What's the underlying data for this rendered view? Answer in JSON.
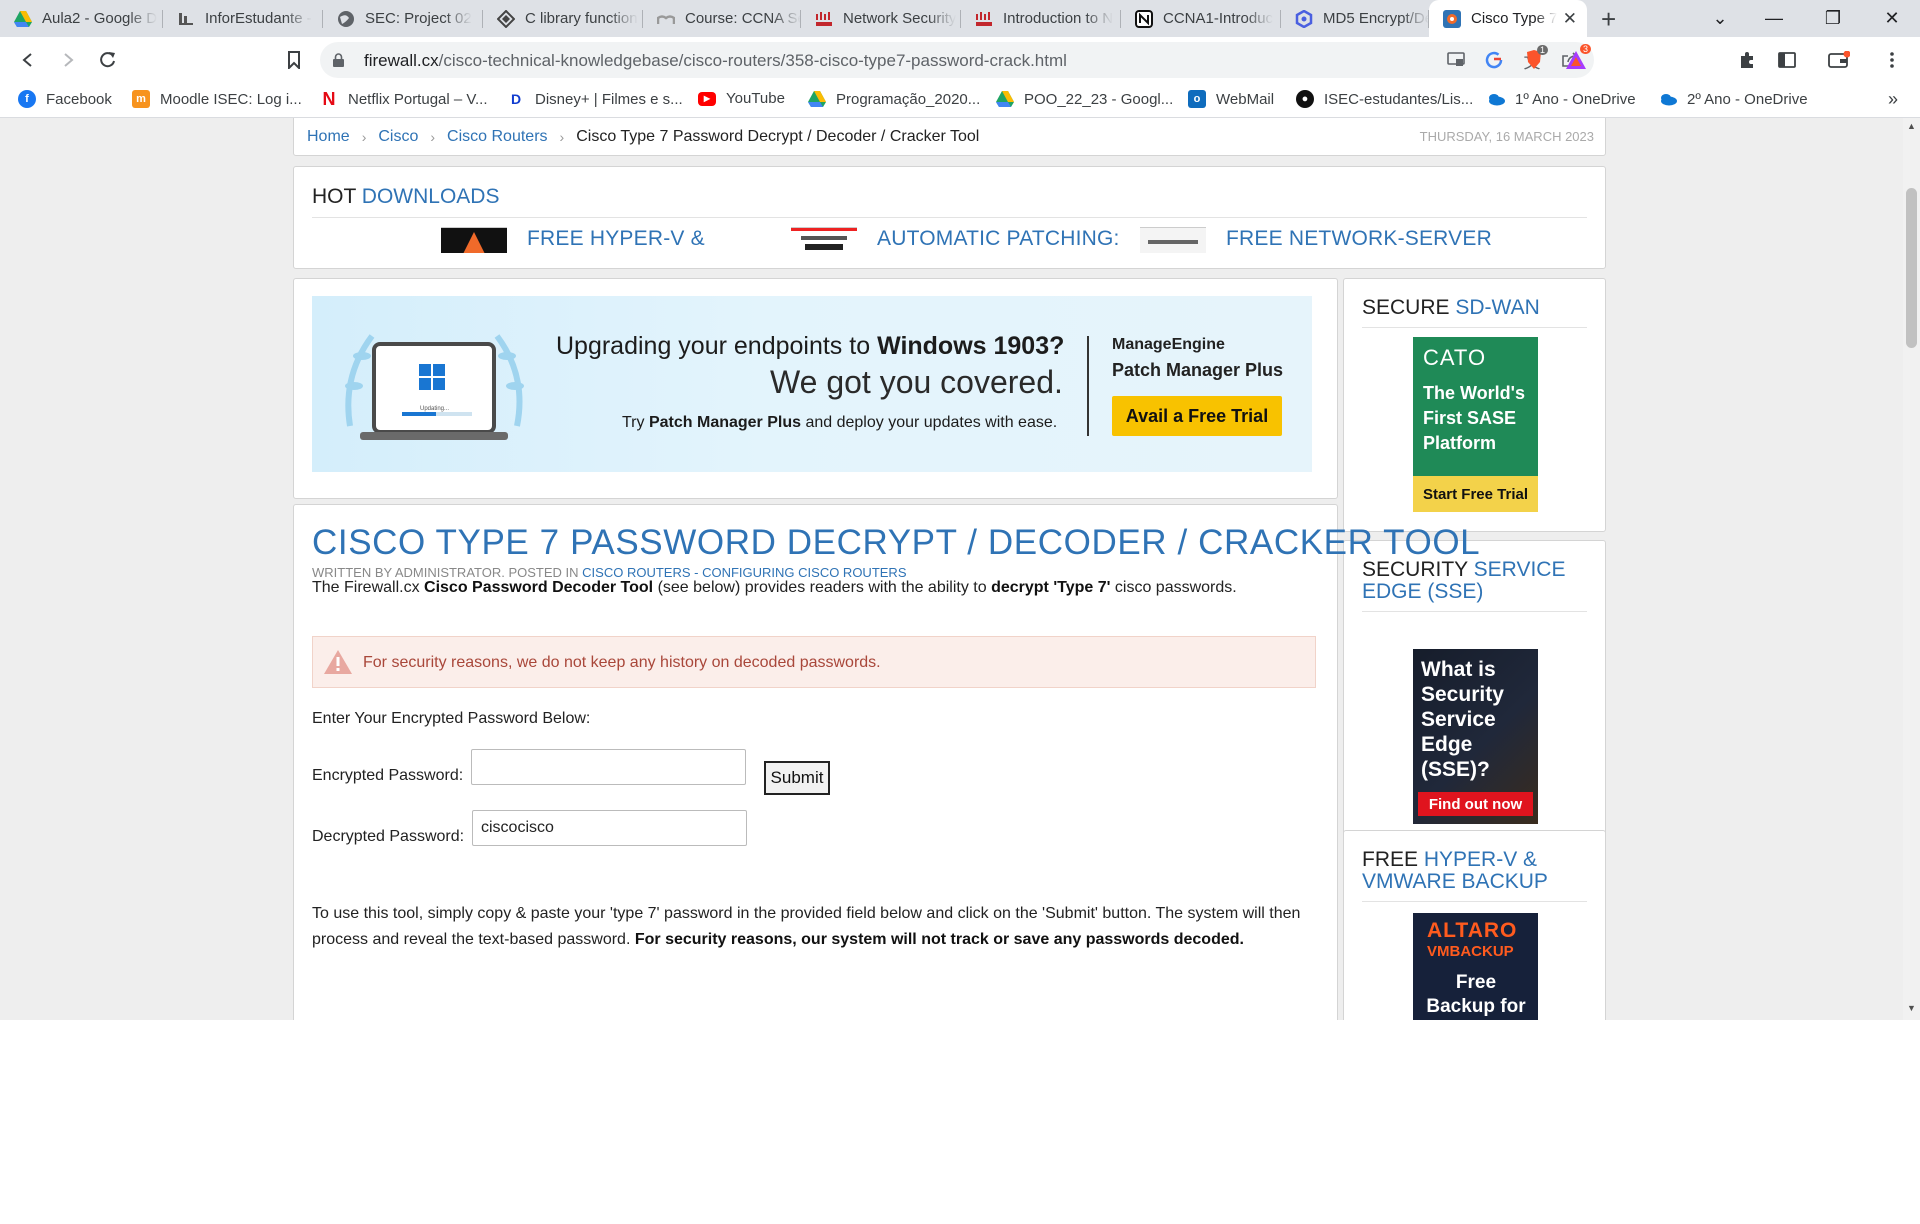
{
  "tabs": [
    {
      "label": "Aula2 - Google D",
      "icon": "google-drive-icon",
      "color": "#1fa463"
    },
    {
      "label": "InforEstudante - ",
      "icon": "inforestudante-icon",
      "color": "#555555"
    },
    {
      "label": "SEC: Project 02",
      "icon": "globe-icon",
      "color": "#5f6368"
    },
    {
      "label": "C library function",
      "icon": "tutorialspoint-icon",
      "color": "#444444"
    },
    {
      "label": "Course: CCNA Se",
      "icon": "moodle-icon",
      "color": "#999999"
    },
    {
      "label": "Network Security",
      "icon": "cisco-icon",
      "color": "#c2272d"
    },
    {
      "label": "Introduction to N",
      "icon": "cisco-icon",
      "color": "#c2272d"
    },
    {
      "label": "CCNA1-Introduc",
      "icon": "notion-icon",
      "color": "#111111"
    },
    {
      "label": "MD5 Encrypt/De",
      "icon": "md5-icon",
      "color": "#4a5fe0"
    },
    {
      "label": "Cisco Type 7",
      "icon": "firewall-cx-icon",
      "color": "#2f73b5",
      "active": true
    }
  ],
  "toolbar": {
    "url_host": "firewall.cx",
    "url_path": "/cisco-technical-knowledgebase/cisco-routers/358-cisco-type7-password-crack.html",
    "brave_badge": "1",
    "rewards_badge": "3"
  },
  "bookmarks": [
    {
      "label": "Facebook",
      "icon": "facebook-icon",
      "color": "#1877f2"
    },
    {
      "label": "Moodle ISEC: Log i...",
      "icon": "moodle-isec-icon",
      "color": "#f7931e"
    },
    {
      "label": "Netflix Portugal – V...",
      "icon": "netflix-icon",
      "color": "#e50914"
    },
    {
      "label": "Disney+ | Filmes e s...",
      "icon": "disney-plus-icon",
      "color": "#113ccf"
    },
    {
      "label": "YouTube",
      "icon": "youtube-icon",
      "color": "#ff0000"
    },
    {
      "label": "Programação_2020...",
      "icon": "google-drive-icon",
      "color": "#fbbc04"
    },
    {
      "label": "POO_22_23 - Googl...",
      "icon": "google-drive-icon",
      "color": "#1fa463"
    },
    {
      "label": "WebMail",
      "icon": "outlook-icon",
      "color": "#0f6cbd"
    },
    {
      "label": "ISEC-estudantes/Lis...",
      "icon": "github-icon",
      "color": "#111111"
    },
    {
      "label": "1º Ano - OneDrive",
      "icon": "onedrive-icon",
      "color": "#0f78d4"
    },
    {
      "label": "2º Ano - OneDrive",
      "icon": "onedrive-icon",
      "color": "#0f78d4"
    }
  ],
  "breadcrumb": {
    "home": "Home",
    "cisco": "Cisco",
    "routers": "Cisco Routers",
    "current": "Cisco Type 7 Password Decrypt / Decoder / Cracker Tool",
    "date": "THURSDAY, 16 MARCH 2023"
  },
  "hot_downloads": {
    "title_plain": "HOT",
    "title_accent": "DOWNLOADS",
    "items": [
      {
        "label": "FREE HYPER-V &"
      },
      {
        "label": "AUTOMATIC PATCHING:"
      },
      {
        "label": "FREE NETWORK-SERVER"
      }
    ]
  },
  "banner": {
    "line1_plain": "Upgrading your endpoints to",
    "line1_bold": "Windows 1903?",
    "line2": "We got you covered.",
    "line3_plain_a": "Try",
    "line3_bold": "Patch Manager Plus",
    "line3_plain_b": "and deploy your updates with ease.",
    "brand": "ManageEngine",
    "product": "Patch Manager Plus",
    "cta": "Avail a Free Trial",
    "updating": "Updating..."
  },
  "sidebar": {
    "sdwan": {
      "title_plain": "SECURE",
      "title_accent": "SD-WAN",
      "ad_logo": "CATO",
      "ad_text": "The World's First SASE Platform",
      "ad_cta": "Start Free Trial"
    },
    "sse": {
      "title_plain": "SECURITY",
      "title_accent": "SERVICE EDGE (SSE)",
      "ad_text": "What is Security Service Edge (SSE)?",
      "ad_cta": "Find out now"
    },
    "hyperv": {
      "title_plain": "FREE",
      "title_accent": "HYPER-V & VMWARE BACKUP",
      "ad_logo": "ALTARO",
      "ad_sub": "VMBACKUP",
      "ad_text": "Free Backup for Hyper-V"
    }
  },
  "article": {
    "title": "CISCO TYPE 7 PASSWORD DECRYPT / DECODER / CRACKER TOOL",
    "meta_plain": "WRITTEN BY ADMINISTRATOR. POSTED IN",
    "meta_link1": "CISCO ROUTERS",
    "meta_sep": "-",
    "meta_link2": "CONFIGURING CISCO ROUTERS",
    "intro_a": "The Firewall.cx",
    "intro_b": "Cisco Password Decoder Tool",
    "intro_c": "(see below) provides readers with the ability to",
    "intro_d": "decrypt",
    "intro_e": "'Type 7'",
    "intro_f": "cisco passwords.",
    "alert": "For security reasons, we do not keep any history on decoded passwords.",
    "enter_label": "Enter Your Encrypted Password Below:",
    "encrypted_label": "Encrypted Password:",
    "encrypted_value": "",
    "submit": "Submit",
    "decrypted_label": "Decrypted Password:",
    "decrypted_value": "ciscocisco",
    "usage_a": "To use this tool, simply copy & paste your 'type 7' password in the provided field below and click on the 'Submit' button. The system will then process and reveal the text-based password.",
    "usage_b": "For security reasons, our system will not track or save any passwords decoded."
  }
}
